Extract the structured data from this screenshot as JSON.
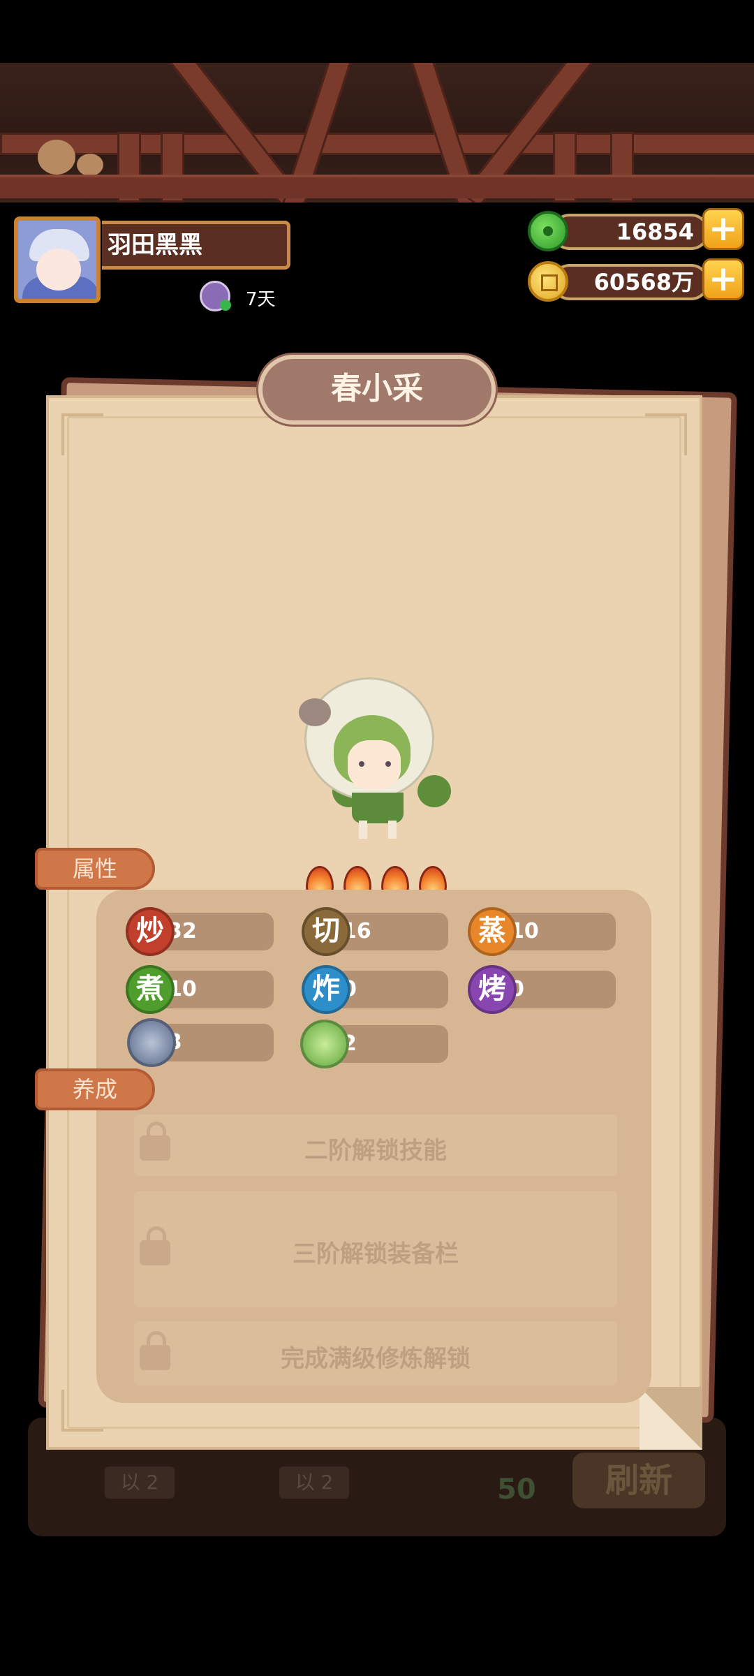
{
  "header": {
    "player_name": "羽田黑黑",
    "subscription_days": "7天"
  },
  "currency": {
    "jade": "16854",
    "coins": "60568万",
    "plus_label": "+"
  },
  "card": {
    "character_name": "春小采",
    "star_level": 4,
    "tabs": {
      "attributes": "属性",
      "training": "养成"
    },
    "stats": [
      {
        "badge": "炒",
        "value": "32",
        "color": "#c2402b"
      },
      {
        "badge": "切",
        "value": "16",
        "color": "#8a6a3a"
      },
      {
        "badge": "蒸",
        "value": "10",
        "color": "#e8862a"
      },
      {
        "badge": "煮",
        "value": "10",
        "color": "#4f9d2c"
      },
      {
        "badge": "炸",
        "value": "0",
        "color": "#2d8ec9"
      },
      {
        "badge": "烤",
        "value": "0",
        "color": "#8a46b0"
      },
      {
        "badge": "",
        "icon": "fish-icon",
        "value": "3"
      },
      {
        "badge": "",
        "icon": "cabbage-icon",
        "value": "2"
      }
    ],
    "locked": [
      "二阶解锁技能",
      "三阶解锁装备栏",
      "完成满级修炼解锁"
    ]
  },
  "background": {
    "chip_1": "以 2",
    "chip_2": "以 2",
    "cost": "50",
    "refresh": "刷新"
  }
}
